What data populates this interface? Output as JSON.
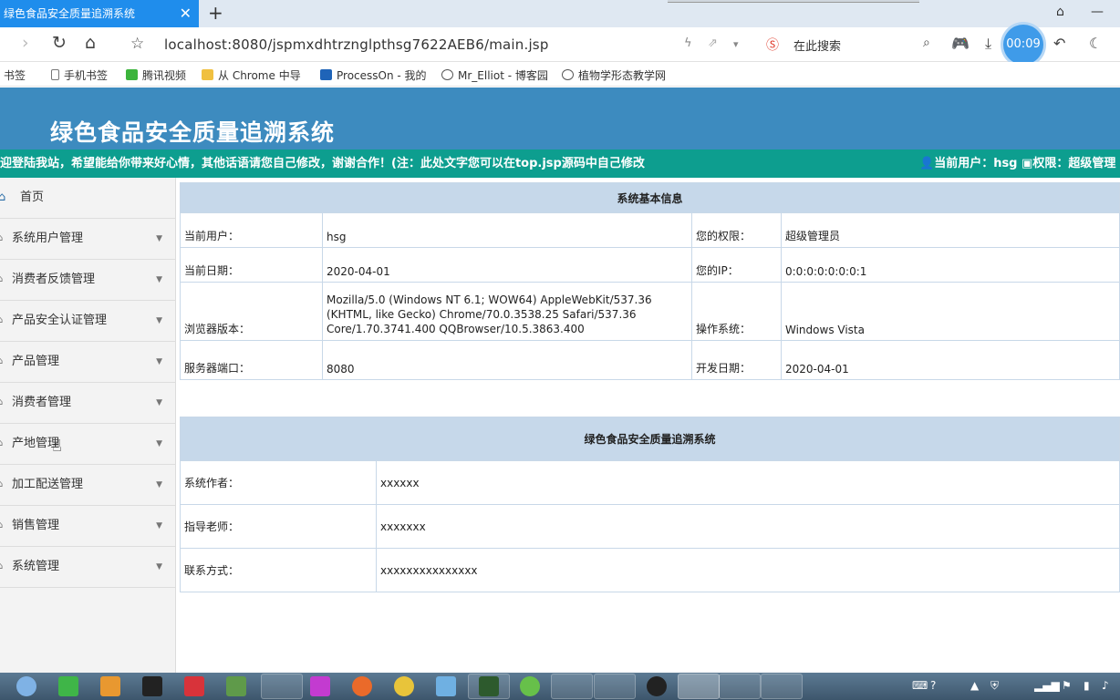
{
  "browser": {
    "tab_title": "绿色食品安全质量追溯系统",
    "url": "localhost:8080/jspmxdhtrznglpthsg7622AEB6/main.jsp",
    "search_placeholder": "在此搜索",
    "timer": "00:09",
    "bookmarks": [
      "书签",
      "手机书签",
      "腾讯视频",
      "从 Chrome 中导",
      "ProcessOn - 我的",
      "Mr_Elliot - 博客园",
      "植物学形态教学网"
    ]
  },
  "header": {
    "title": "绿色食品安全质量追溯系统",
    "marquee": "迎登陆我站，希望能给你带来好心情，其他话语请您自己修改，谢谢合作！(注：此处文字您可以在top.jsp源码中自己修改",
    "current_user": "当前用户：hsg",
    "permission": "权限：超级管理"
  },
  "sidebar": {
    "home": "首页",
    "items": [
      "系统用户管理",
      "消费者反馈管理",
      "产品安全认证管理",
      "产品管理",
      "消费者管理",
      "产地管理",
      "加工配送管理",
      "销售管理",
      "系统管理"
    ]
  },
  "info": {
    "heading": "系统基本信息",
    "rows": [
      {
        "l1": "当前用户：",
        "v1": "hsg",
        "l2": "您的权限：",
        "v2": "超级管理员"
      },
      {
        "l1": "当前日期：",
        "v1": "2020-04-01",
        "l2": "您的IP：",
        "v2": "0:0:0:0:0:0:0:1"
      },
      {
        "l1": "浏览器版本：",
        "v1": "Mozilla/5.0 (Windows NT 6.1; WOW64) AppleWebKit/537.36 (KHTML, like Gecko) Chrome/70.0.3538.25 Safari/537.36 Core/1.70.3741.400 QQBrowser/10.5.3863.400",
        "l2": "操作系统：",
        "v2": "Windows Vista"
      },
      {
        "l1": "服务器端口：",
        "v1": "8080",
        "l2": "开发日期：",
        "v2": "2020-04-01"
      }
    ]
  },
  "sys": {
    "heading": "绿色食品安全质量追溯系统",
    "rows": [
      {
        "label": "系统作者：",
        "value": "xxxxxx"
      },
      {
        "label": "指导老师：",
        "value": "xxxxxxx"
      },
      {
        "label": "联系方式：",
        "value": "xxxxxxxxxxxxxxx"
      }
    ]
  },
  "colors": {
    "header": "#3d8bbf",
    "marquee": "#0d9e8f",
    "table_head": "#c6d8ea"
  }
}
